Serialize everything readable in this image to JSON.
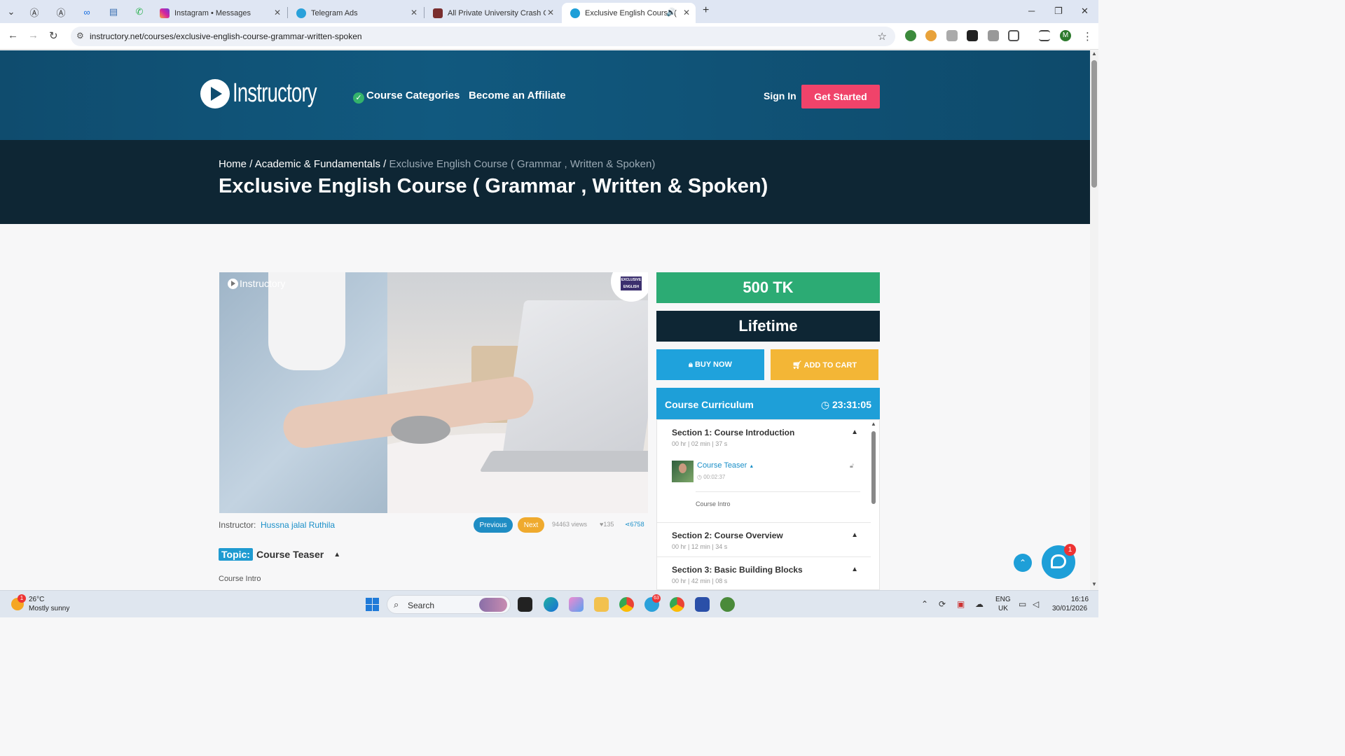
{
  "browser": {
    "tabs": [
      {
        "title": "",
        "icon": "tab-list-icon"
      },
      {
        "title": "",
        "icon": "threads-icon"
      },
      {
        "title": "",
        "icon": "threads-icon"
      },
      {
        "title": "",
        "icon": "meta-icon"
      },
      {
        "title": "",
        "icon": "blue-icon"
      },
      {
        "title": "",
        "icon": "whatsapp-icon"
      },
      {
        "title": "Instagram • Messages",
        "icon": "instagram-icon"
      },
      {
        "title": "Telegram Ads",
        "icon": "telegram-icon"
      },
      {
        "title": "All Private University Crash Cou",
        "icon": "university-icon"
      },
      {
        "title": "Exclusive English Course ( G",
        "icon": "instructory-icon"
      }
    ],
    "url": "instructory.net/courses/exclusive-english-course-grammar-written-spoken"
  },
  "header": {
    "brand": "Instructory",
    "nav": [
      "Course Categories",
      "Become an Affiliate"
    ],
    "sign_in": "Sign In",
    "get_started": "Get Started"
  },
  "title_band": {
    "breadcrumb": [
      "Home",
      "Academic & Fundamentals",
      "Exclusive English Course ( Grammar , Written & Spoken)"
    ],
    "separator": "/",
    "title": "Exclusive English Course ( Grammar , Written & Spoken)"
  },
  "video": {
    "watermark": "Instructory",
    "badge_text": "EXCLUSIVE ENGLISH"
  },
  "meta": {
    "instructor_label": "Instructor:",
    "instructor_name": "Hussna jalal Ruthila",
    "previous": "Previous",
    "next": "Next",
    "views": "94463 views",
    "likes": "135",
    "shares": "6758"
  },
  "topic": {
    "tag": "Topic:",
    "name": "Course Teaser",
    "sub": "Course Intro"
  },
  "sidebar": {
    "price": "500 TK",
    "lifetime": "Lifetime",
    "buy_now": "BUY NOW",
    "add_to_cart": "ADD TO CART",
    "curriculum_title": "Course Curriculum",
    "curriculum_time": "23:31:05",
    "sections": [
      {
        "title": "Section 1: Course Introduction",
        "duration": "00 hr | 02 min | 37 s"
      },
      {
        "title": "Section 2: Course Overview",
        "duration": "00 hr | 12 min | 34 s"
      },
      {
        "title": "Section 3: Basic Building Blocks",
        "duration": "00 hr | 42 min | 08 s"
      }
    ],
    "lesson": {
      "title": "Course Teaser",
      "time": "00:02:37",
      "intro": "Course Intro"
    }
  },
  "chat": {
    "badge": "1"
  },
  "taskbar": {
    "temp": "26°C",
    "weather": "Mostly sunny",
    "weather_badge": "1",
    "search": "Search",
    "telegram_badge": "63",
    "lang1": "ENG",
    "lang2": "UK",
    "time": "16:16",
    "date": "30/01/2026"
  }
}
